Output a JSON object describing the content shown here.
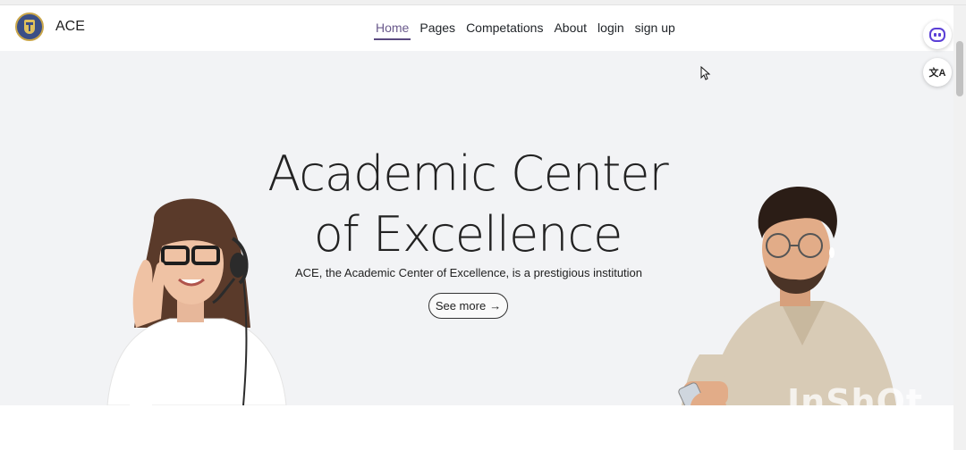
{
  "brand": {
    "name": "ACE",
    "logo_icon": "crest-logo-icon"
  },
  "nav": {
    "items": [
      {
        "label": "Home",
        "active": true
      },
      {
        "label": "Pages",
        "active": false
      },
      {
        "label": "Competations",
        "active": false
      },
      {
        "label": "About",
        "active": false
      },
      {
        "label": "login",
        "active": false
      },
      {
        "label": "sign up",
        "active": false
      }
    ]
  },
  "hero": {
    "title_line1": "Academic Center",
    "title_line2": "of Excellence",
    "subtitle": "ACE, the Academic Center of Excellence, is a prestigious institution",
    "cta_label": "See more",
    "cta_icon": "arrow-right-icon"
  },
  "side_buttons": {
    "copilot_icon": "copilot-icon",
    "translate_label": "文A"
  },
  "watermark": "InShOt",
  "colors": {
    "accent": "#5a4a80",
    "hero_bg": "#f2f3f5"
  }
}
